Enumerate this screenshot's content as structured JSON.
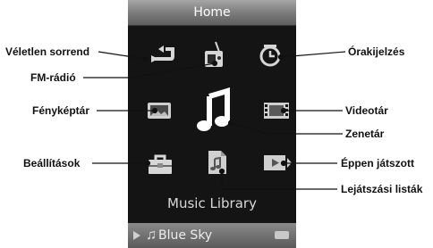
{
  "screen": {
    "header_title": "Home",
    "menu_caption": "Music Library",
    "now_playing": {
      "track": "Blue Sky"
    }
  },
  "menu_items": [
    {
      "id": "shuffle",
      "icon": "shuffle-icon",
      "selected": false
    },
    {
      "id": "fm-radio",
      "icon": "fm-radio-icon",
      "selected": false
    },
    {
      "id": "clock",
      "icon": "clock-icon",
      "selected": false
    },
    {
      "id": "photo",
      "icon": "photo-icon",
      "selected": false
    },
    {
      "id": "music",
      "icon": "music-note-icon",
      "selected": true
    },
    {
      "id": "video",
      "icon": "video-icon",
      "selected": false
    },
    {
      "id": "settings",
      "icon": "toolbox-icon",
      "selected": false
    },
    {
      "id": "playlists",
      "icon": "playlist-icon",
      "selected": false
    },
    {
      "id": "now-playing",
      "icon": "now-playing-icon",
      "selected": false
    }
  ],
  "callouts": {
    "veletlen": "Véletlen sorrend",
    "fm": "FM-rádió",
    "ora": "Órakijelzés",
    "foto": "Fényképtár",
    "video": "Videotár",
    "zene": "Zenetár",
    "beall": "Beállítások",
    "eppen": "Éppen játszott",
    "lejatszasi": "Lejátszási listák"
  }
}
